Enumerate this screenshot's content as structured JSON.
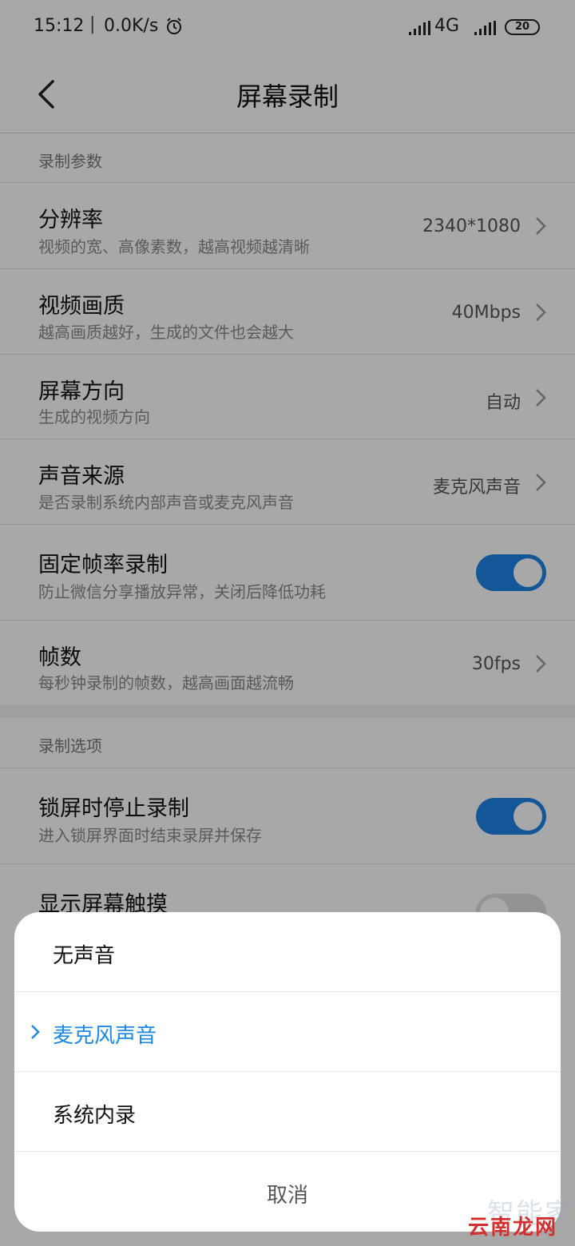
{
  "status_bar": {
    "time": "15:12",
    "separator": "|",
    "speed": "0.0K/s",
    "network": "4G",
    "battery": "20"
  },
  "title_bar": {
    "title": "屏幕录制"
  },
  "sections": [
    {
      "header": "录制参数",
      "items": [
        {
          "title": "分辨率",
          "subtitle": "视频的宽、高像素数，越高视频越清晰",
          "value": "2340*1080",
          "type": "chevron"
        },
        {
          "title": "视频画质",
          "subtitle": "越高画质越好，生成的文件也会越大",
          "value": "40Mbps",
          "type": "chevron"
        },
        {
          "title": "屏幕方向",
          "subtitle": "生成的视频方向",
          "value": "自动",
          "type": "chevron"
        },
        {
          "title": "声音来源",
          "subtitle": "是否录制系统内部声音或麦克风声音",
          "value": "麦克风声音",
          "type": "chevron"
        },
        {
          "title": "固定帧率录制",
          "subtitle": "防止微信分享播放异常，关闭后降低功耗",
          "type": "toggle",
          "on": true
        },
        {
          "title": "帧数",
          "subtitle": "每秒钟录制的帧数，越高画面越流畅",
          "value": "30fps",
          "type": "chevron"
        }
      ]
    },
    {
      "header": "录制选项",
      "items": [
        {
          "title": "锁屏时停止录制",
          "subtitle": "进入锁屏界面时结束录屏并保存",
          "type": "toggle",
          "on": true
        },
        {
          "title": "显示屏幕触摸",
          "type": "toggle",
          "on": false
        }
      ]
    }
  ],
  "sheet": {
    "options": [
      {
        "label": "无声音",
        "selected": false
      },
      {
        "label": "麦克风声音",
        "selected": true
      },
      {
        "label": "系统内录",
        "selected": false
      }
    ],
    "cancel": "取消"
  },
  "watermark": {
    "line1": "智能家",
    "line2": "云南龙网"
  },
  "colors": {
    "accent": "#1d84e8",
    "selected_text": "#1b88e6",
    "overlay": "rgba(0,0,0,0.34)"
  }
}
